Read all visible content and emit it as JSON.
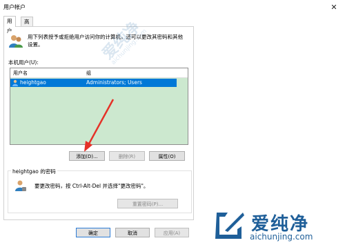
{
  "window": {
    "title": "用户帐户",
    "close_glyph": "✕"
  },
  "tabs": [
    {
      "label": "用户"
    },
    {
      "label": "高级"
    }
  ],
  "intro_text_line1": "用下列表授予或拒绝用户访问你的计算机，还可以更改其密码和其他",
  "intro_text_line2": "设置。",
  "users_label": "本机用户(U):",
  "table": {
    "columns": [
      "用户名",
      "组"
    ],
    "rows": [
      {
        "username": "heightgao",
        "group": "Administrators; Users",
        "selected": true
      }
    ]
  },
  "user_buttons": {
    "add": "添加(D)...",
    "delete": "删除(R)",
    "properties": "属性(O)"
  },
  "password_group": {
    "title": "heightgao 的密码",
    "text": "要更改密码，按 Ctrl-Alt-Del 并选择\"更改密码\"。",
    "reset_button": "重置密码(P)..."
  },
  "dialog_buttons": {
    "ok": "确定",
    "cancel": "取消",
    "apply": "应用(A)"
  },
  "watermark": {
    "brand": "爱纯净",
    "url": "aichunjing.com"
  },
  "colors": {
    "list_background": "#cce8cf",
    "selection": "#0078d7",
    "arrow": "#e53228"
  }
}
